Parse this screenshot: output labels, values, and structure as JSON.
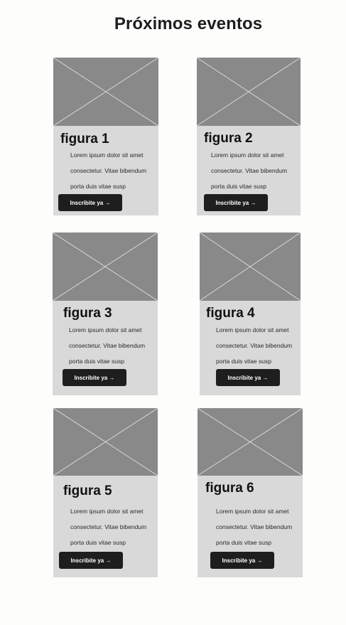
{
  "page": {
    "title": "Próximos eventos"
  },
  "cards": [
    {
      "title": "figura 1",
      "desc": [
        "Lorem ipsum dolor sit amet",
        "consectetur. Vitae bibendum",
        "porta duis vitae susp"
      ],
      "button_label": "Inscribite ya →"
    },
    {
      "title": "figura 2",
      "desc": [
        "Lorem ipsum dolor sit amet",
        "consectetur. Vitae bibendum",
        "porta duis vitae susp"
      ],
      "button_label": "Inscribite ya →"
    },
    {
      "title": "figura 3",
      "desc": [
        "Lorem ipsum dolor sit amet",
        "consectetur. Vitae bibendum",
        "porta duis vitae susp"
      ],
      "button_label": "Inscribite ya →"
    },
    {
      "title": "figura 4",
      "desc": [
        "Lorem ipsum dolor sit amet",
        "consectetur. Vitae bibendum",
        "porta duis vitae susp"
      ],
      "button_label": "Inscribite ya →"
    },
    {
      "title": "figura 5",
      "desc": [
        "Lorem ipsum dolor sit amet",
        "consectetur. Vitae bibendum",
        "porta duis vitae susp"
      ],
      "button_label": "Inscribite ya →"
    },
    {
      "title": "figura 6",
      "desc": [
        "Lorem ipsum dolor sit amet",
        "consectetur. Vitae bibendum",
        "porta duis vitae susp"
      ],
      "button_label": "Inscribite ya →"
    }
  ],
  "colors": {
    "background": "#fdfdfb",
    "card": "#d9d9d9",
    "image_placeholder": "#898989",
    "button": "#1e1e1e",
    "button_text": "#ffffff"
  }
}
